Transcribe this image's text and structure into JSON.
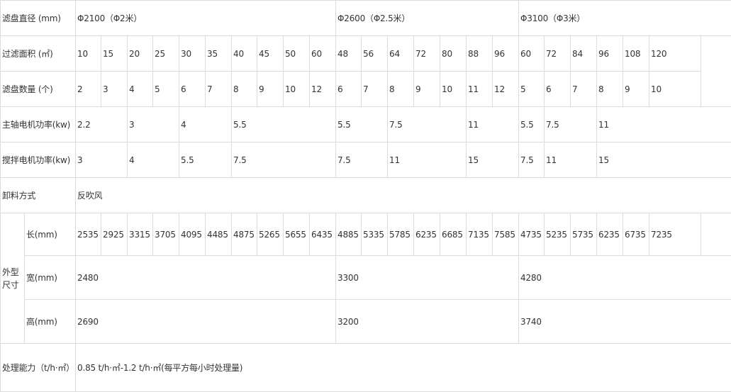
{
  "rows": {
    "diameter": {
      "label": "滤盘直径 (mm)",
      "groups": [
        "Φ2100（Φ2米）",
        "Φ2600（Φ2.5米）",
        "Φ3100（Φ3米）"
      ]
    },
    "area": {
      "label": "过滤面积 (㎡)",
      "values": [
        "10",
        "15",
        "20",
        "25",
        "30",
        "35",
        "40",
        "45",
        "50",
        "60",
        "48",
        "56",
        "64",
        "72",
        "80",
        "88",
        "96",
        "60",
        "72",
        "84",
        "96",
        "108",
        "120"
      ]
    },
    "disc_count": {
      "label": "滤盘数量 (个)",
      "values": [
        "2",
        "3",
        "4",
        "5",
        "6",
        "7",
        "8",
        "9",
        "10",
        "12",
        "6",
        "7",
        "8",
        "9",
        "10",
        "11",
        "12",
        "5",
        "6",
        "7",
        "8",
        "9",
        "10"
      ]
    },
    "main_motor": {
      "label": "主轴电机功率(kw)",
      "values": [
        "2.2",
        "3",
        "4",
        "5.5",
        "5.5",
        "7.5",
        "11",
        "5.5",
        "7.5",
        "11"
      ]
    },
    "stir_motor": {
      "label": "搅拌电机功率(kw)",
      "values": [
        "3",
        "4",
        "5.5",
        "7.5",
        "7.5",
        "11",
        "15",
        "7.5",
        "11",
        "15"
      ]
    },
    "discharge": {
      "label": "卸料方式",
      "value": "反吹风"
    },
    "dimensions": {
      "label": "外型尺寸",
      "length_label": "长(mm)",
      "length_values": [
        "2535",
        "2925",
        "3315",
        "3705",
        "4095",
        "4485",
        "4875",
        "5265",
        "5655",
        "6435",
        "4885",
        "5335",
        "5785",
        "6235",
        "6685",
        "7135",
        "7585",
        "4735",
        "5235",
        "5735",
        "6235",
        "6735",
        "7235"
      ],
      "width_label": "宽(mm)",
      "width_values": [
        "2480",
        "3300",
        "4280"
      ],
      "height_label": "高(mm)",
      "height_values": [
        "2690",
        "3200",
        "3740"
      ]
    },
    "capacity": {
      "label": "处理能力（t/h·㎡）",
      "value": "0.85 t/h·㎡-1.2 t/h·㎡(每平方每小时处理量)"
    }
  }
}
